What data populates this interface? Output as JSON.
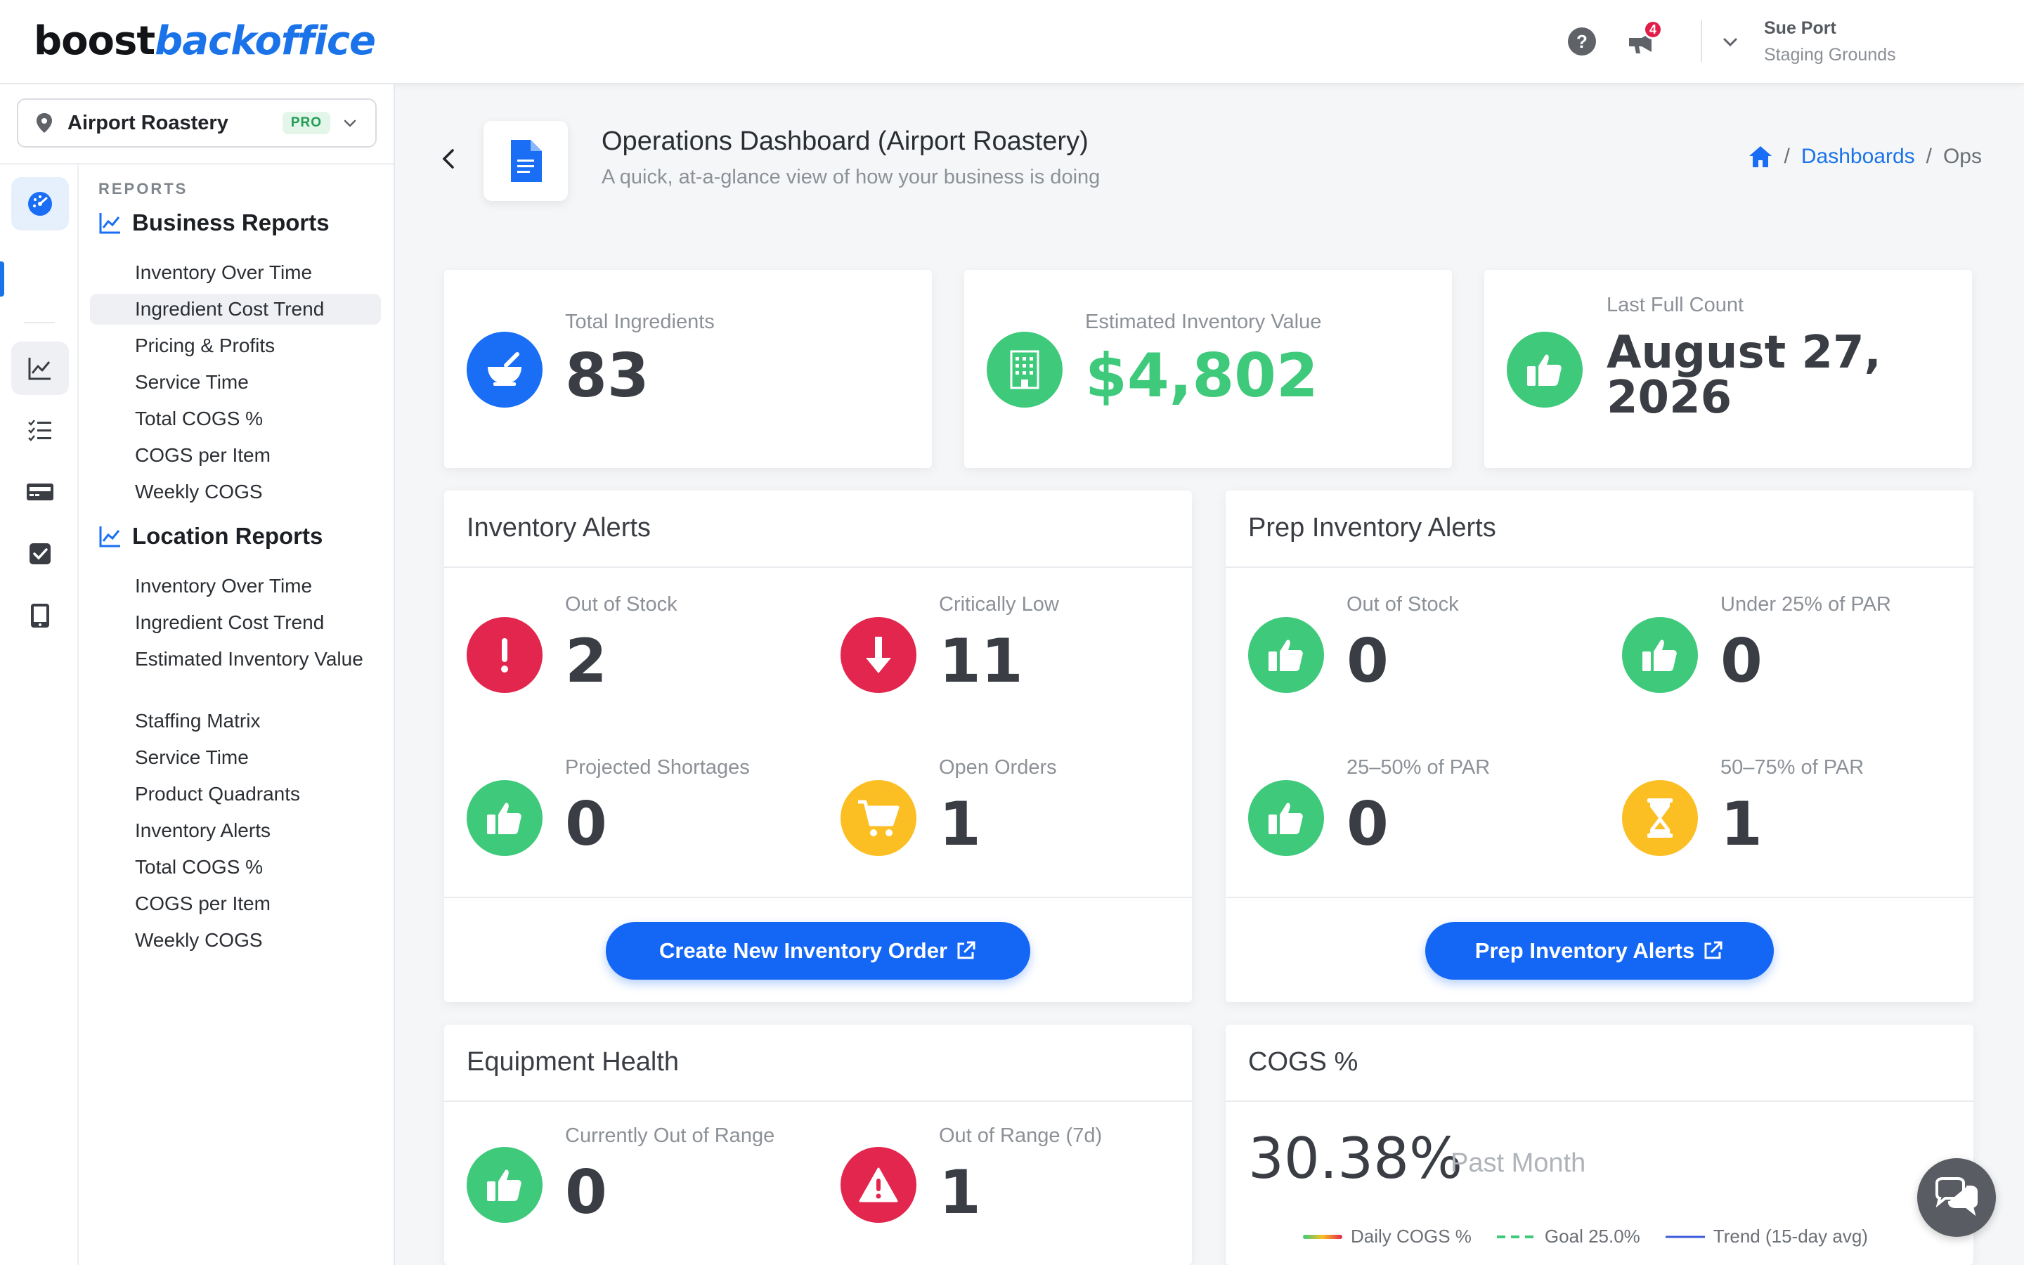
{
  "header": {
    "logo_part1": "boost",
    "logo_part2": "backoffice",
    "notifications_count": "4",
    "user_name": "Sue Port",
    "user_org": "Staging Grounds"
  },
  "sidebar": {
    "location": "Airport Roastery",
    "plan_badge": "PRO",
    "reports_heading": "REPORTS",
    "business_section": "Business Reports",
    "business_items": [
      "Inventory Over Time",
      "Ingredient Cost Trend",
      "Pricing & Profits",
      "Service Time",
      "Total COGS %",
      "COGS per Item",
      "Weekly COGS"
    ],
    "location_section": "Location Reports",
    "location_items": [
      "Inventory Over Time",
      "Ingredient Cost Trend",
      "Estimated Inventory Value",
      "Staffing Matrix",
      "Service Time",
      "Product Quadrants",
      "Inventory Alerts",
      "Total COGS %",
      "COGS per Item",
      "Weekly COGS"
    ]
  },
  "page": {
    "title": "Operations Dashboard (Airport Roastery)",
    "subtitle": "A quick, at-a-glance view of how your business is doing",
    "breadcrumb": [
      "Dashboards",
      "Ops"
    ]
  },
  "stats": {
    "total_ingredients_label": "Total Ingredients",
    "total_ingredients_value": "83",
    "inventory_value_label": "Estimated Inventory Value",
    "inventory_value_value": "$4,802",
    "last_count_label": "Last Full Count",
    "last_count_line1": "August 27,",
    "last_count_line2": "2026"
  },
  "inventory_alerts": {
    "title": "Inventory Alerts",
    "out_of_stock_label": "Out of Stock",
    "out_of_stock_value": "2",
    "critically_low_label": "Critically Low",
    "critically_low_value": "11",
    "projected_shortages_label": "Projected Shortages",
    "projected_shortages_value": "0",
    "open_orders_label": "Open Orders",
    "open_orders_value": "1",
    "button": "Create New Inventory Order"
  },
  "prep_alerts": {
    "title": "Prep Inventory Alerts",
    "out_of_stock_label": "Out of Stock",
    "out_of_stock_value": "0",
    "under_25_label": "Under 25% of PAR",
    "under_25_value": "0",
    "p25_50_label": "25–50% of PAR",
    "p25_50_value": "0",
    "p50_75_label": "50–75% of PAR",
    "p50_75_value": "1",
    "button": "Prep Inventory Alerts"
  },
  "equipment": {
    "title": "Equipment Health",
    "current_label": "Currently Out of Range",
    "current_value": "0",
    "week_label": "Out of Range (7d)",
    "week_value": "1"
  },
  "cogs": {
    "title": "COGS %",
    "value": "30.38%",
    "period": "Past Month",
    "legend": [
      "Daily COGS %",
      "Goal 25.0%",
      "Trend (15-day avg)"
    ]
  },
  "colors": {
    "primary": "#1a6ef5",
    "success": "#3ec97b",
    "danger": "#e2264d",
    "warning": "#fbbf24"
  }
}
